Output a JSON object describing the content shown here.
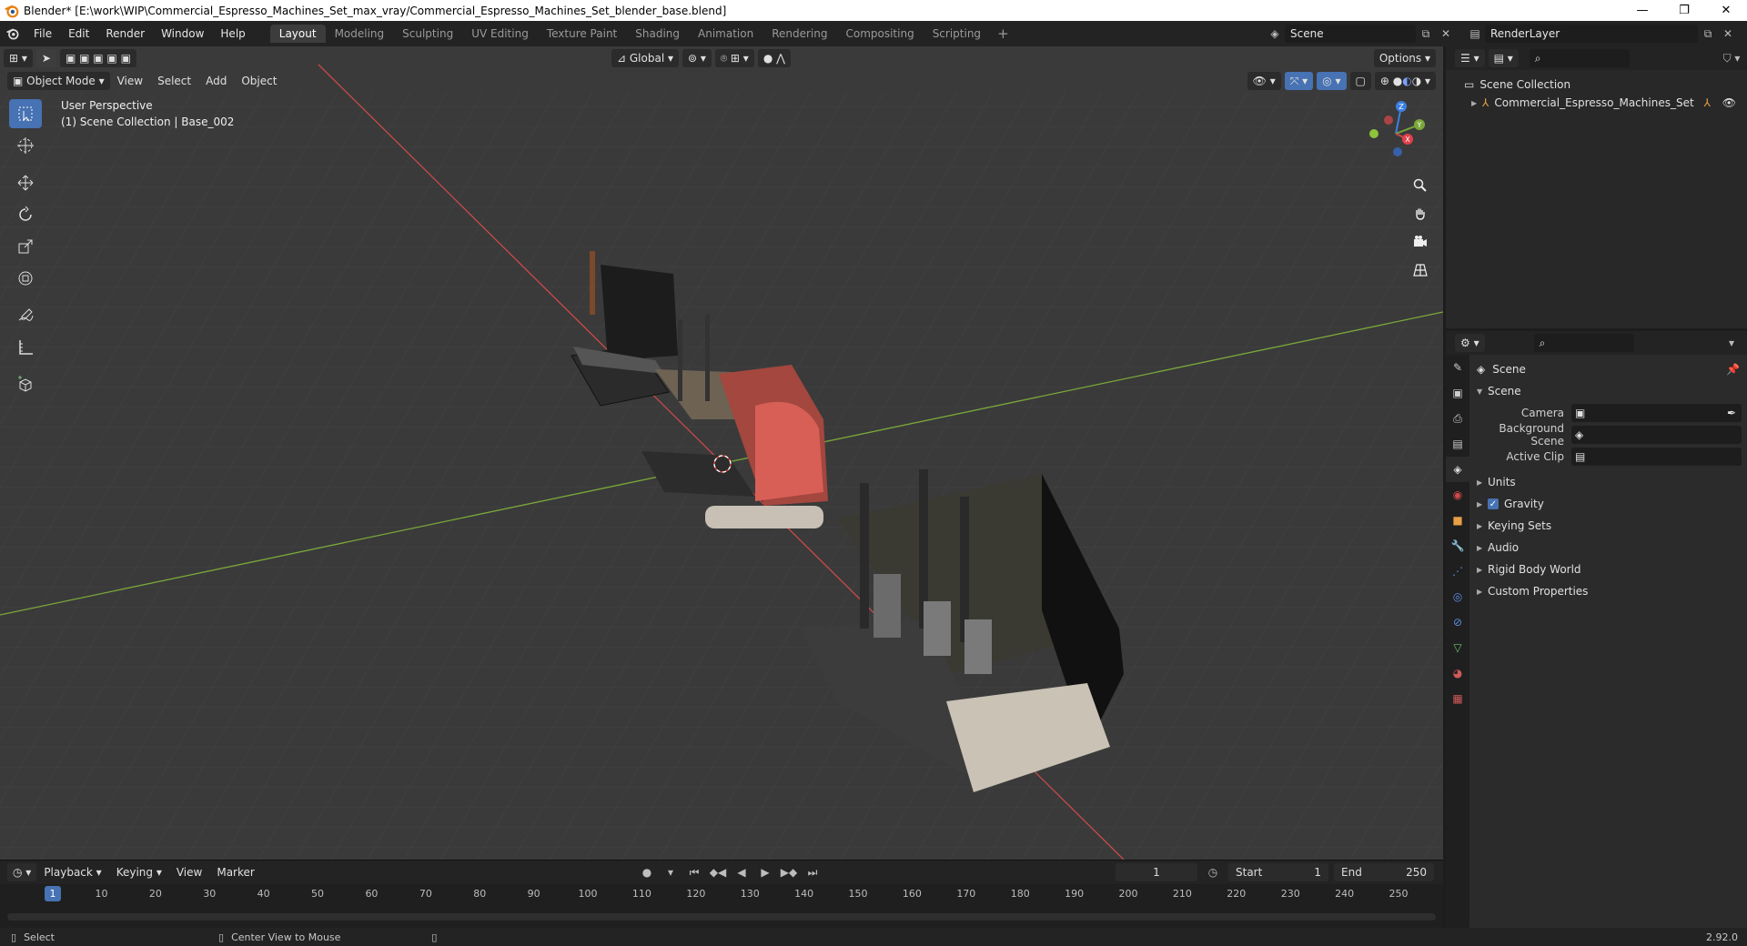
{
  "window": {
    "title": "Blender* [E:\\work\\WIP\\Commercial_Espresso_Machines_Set_max_vray/Commercial_Espresso_Machines_Set_blender_base.blend]",
    "minimize": "—",
    "maximize": "❐",
    "close": "✕"
  },
  "menu": [
    "File",
    "Edit",
    "Render",
    "Window",
    "Help"
  ],
  "workspaces": [
    {
      "label": "Layout",
      "active": true
    },
    {
      "label": "Modeling",
      "active": false
    },
    {
      "label": "Sculpting",
      "active": false
    },
    {
      "label": "UV Editing",
      "active": false
    },
    {
      "label": "Texture Paint",
      "active": false
    },
    {
      "label": "Shading",
      "active": false
    },
    {
      "label": "Animation",
      "active": false
    },
    {
      "label": "Rendering",
      "active": false
    },
    {
      "label": "Compositing",
      "active": false
    },
    {
      "label": "Scripting",
      "active": false
    }
  ],
  "scene_name": "Scene",
  "view_layer": "RenderLayer",
  "viewport": {
    "transform_orientation": "Global",
    "options_label": "Options",
    "mode": "Object Mode",
    "menus": [
      "View",
      "Select",
      "Add",
      "Object"
    ],
    "perspective_label": "User Perspective",
    "collection_label": "(1) Scene Collection | Base_002",
    "axes": {
      "x": "X",
      "y": "Y",
      "z": "Z"
    }
  },
  "timeline": {
    "menus": [
      "Playback",
      "Keying",
      "View",
      "Marker"
    ],
    "current_frame": "1",
    "start_label": "Start",
    "start": "1",
    "end_label": "End",
    "end": "250",
    "ticks": [
      "1",
      "10",
      "20",
      "30",
      "40",
      "50",
      "60",
      "70",
      "80",
      "90",
      "100",
      "110",
      "120",
      "130",
      "140",
      "150",
      "160",
      "170",
      "180",
      "190",
      "200",
      "210",
      "220",
      "230",
      "240",
      "250"
    ]
  },
  "statusbar": {
    "left": "Select",
    "middle": "Center View to Mouse",
    "version": "2.92.0"
  },
  "outliner": {
    "root": "Scene Collection",
    "items": [
      {
        "label": "Commercial_Espresso_Machines_Set"
      }
    ]
  },
  "properties": {
    "context": "Scene",
    "panel_title": "Scene",
    "fields": [
      {
        "label": "Camera",
        "value": ""
      },
      {
        "label": "Background Scene",
        "value": ""
      },
      {
        "label": "Active Clip",
        "value": ""
      }
    ],
    "panels": [
      {
        "label": "Units",
        "checkbox": false
      },
      {
        "label": "Gravity",
        "checkbox": true
      },
      {
        "label": "Keying Sets",
        "checkbox": false
      },
      {
        "label": "Audio",
        "checkbox": false
      },
      {
        "label": "Rigid Body World",
        "checkbox": false
      },
      {
        "label": "Custom Properties",
        "checkbox": false
      }
    ]
  },
  "colors": {
    "accent": "#4772b3",
    "x_axis": "#c94a4a",
    "y_axis": "#7aa83a",
    "z_axis": "#3d7fe0"
  }
}
